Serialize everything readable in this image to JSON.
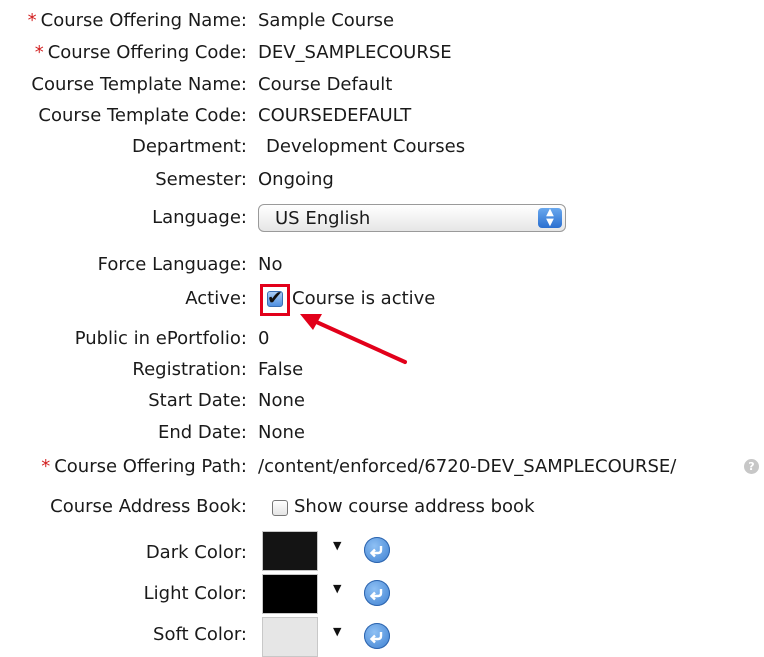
{
  "fields": {
    "offering_name": {
      "label": "Course Offering Name:",
      "value": "Sample Course",
      "required": true
    },
    "offering_code": {
      "label": "Course Offering Code:",
      "value": "DEV_SAMPLECOURSE",
      "required": true
    },
    "template_name": {
      "label": "Course Template Name:",
      "value": "Course Default"
    },
    "template_code": {
      "label": "Course Template Code:",
      "value": "COURSEDEFAULT"
    },
    "department": {
      "label": "Department:",
      "value": "Development Courses"
    },
    "semester": {
      "label": "Semester:",
      "value": "Ongoing"
    },
    "language": {
      "label": "Language:",
      "value": "US English"
    },
    "force_language": {
      "label": "Force Language:",
      "value": "No"
    },
    "active": {
      "label": "Active:",
      "checkbox_label": "Course is active",
      "checked": true
    },
    "public_eportfolio": {
      "label": "Public in ePortfolio:",
      "value": "0"
    },
    "registration": {
      "label": "Registration:",
      "value": "False"
    },
    "start_date": {
      "label": "Start Date:",
      "value": "None"
    },
    "end_date": {
      "label": "End Date:",
      "value": "None"
    },
    "offering_path": {
      "label": "Course Offering Path:",
      "value": "/content/enforced/6720-DEV_SAMPLECOURSE/",
      "required": true
    },
    "address_book": {
      "label": "Course Address Book:",
      "checkbox_label": "Show course address book",
      "checked": false
    },
    "dark_color": {
      "label": "Dark Color:",
      "color": "#141414"
    },
    "light_color": {
      "label": "Light Color:",
      "color": "#000000"
    },
    "soft_color": {
      "label": "Soft Color:",
      "color": "#e6e6e6"
    }
  },
  "required_marker": "*",
  "help_icon_glyph": "?",
  "annotation": {
    "color": "#e2001a"
  }
}
